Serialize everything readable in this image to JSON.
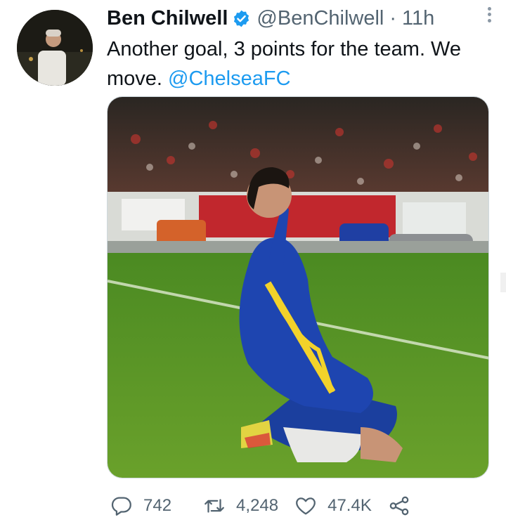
{
  "tweet": {
    "display_name": "Ben Chilwell",
    "handle": "@BenChilwell",
    "separator": "·",
    "time": "11h",
    "text_line1": "Another goal, 3 points for the team. We",
    "text_line2_plain": "move. ",
    "mention": "@ChelseaFC"
  },
  "actions": {
    "reply_count": "742",
    "retweet_count": "4,248",
    "like_count": "47.4K"
  },
  "icons": {
    "verified": "verified-badge-icon",
    "more": "more-dots-icon",
    "reply": "reply-icon",
    "retweet": "retweet-icon",
    "like": "heart-icon",
    "share": "share-icon"
  },
  "colors": {
    "accent": "#1d9bf0",
    "secondary_text": "#536471",
    "primary_text": "#0f1419"
  }
}
